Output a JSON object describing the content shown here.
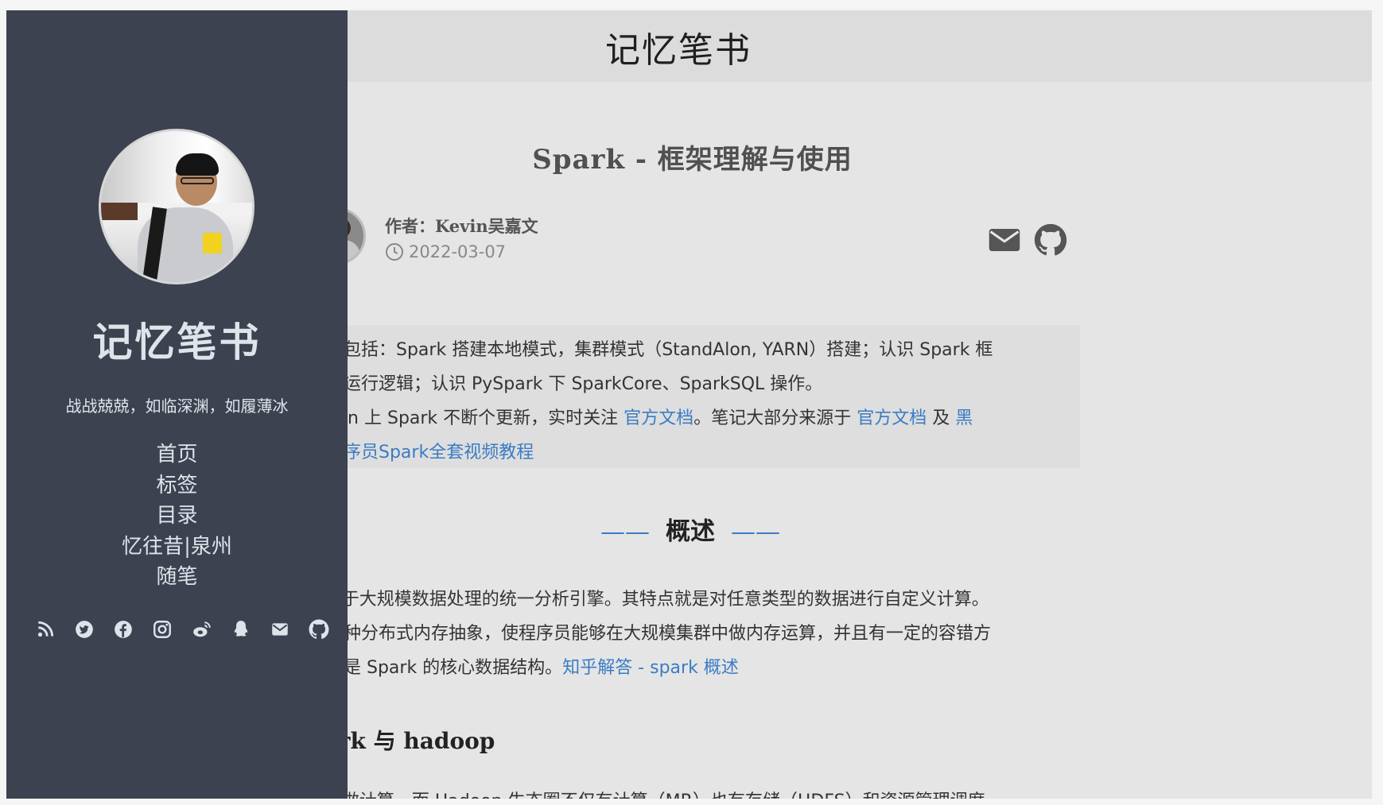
{
  "header": {
    "site_title": "记忆笔书"
  },
  "sidebar": {
    "title": "记忆笔书",
    "motto": "战战兢兢，如临深渊，如履薄冰",
    "nav": [
      "首页",
      "标签",
      "目录",
      "忆往昔|泉州",
      "随笔"
    ],
    "social_icons": [
      "rss-icon",
      "twitter-icon",
      "facebook-icon",
      "instagram-icon",
      "weibo-icon",
      "qq-icon",
      "mail-icon",
      "github-icon"
    ]
  },
  "post": {
    "title": "Spark - 框架理解与使用",
    "author": "作者：Kevin吴嘉文",
    "date": "2022-03-07",
    "meta_icons": [
      "mail-icon",
      "github-icon"
    ]
  },
  "quote": {
    "line1": "内容包括：Spark 搭建本地模式，集群模式（StandAlon, YARN）搭建；认识 Spark 框",
    "line2": "果、运行逻辑；认识 PySpark 下 SparkCore、SparkSQL 操作。",
    "line3_pre": "ython 上 Spark 不断个更新，实时关注 ",
    "link1": "官方文档",
    "line3_mid": "。笔记大部分来源于 ",
    "link2": "官方文档",
    "line3_and": " 及 ",
    "link3a": "黑",
    "link3b": "马程序员Spark全套视频教程"
  },
  "section": {
    "dash_left": "——",
    "heading": "概述",
    "dash_right": "——"
  },
  "overview": {
    "line1": "k 用于大规模数据处理的统一分析引擎。其特点就是对任意类型的数据进行自定义计算。",
    "line2": "是一种分布式内存抽象，使程序员能够在大规模集群中做内存运算，并且有一定的容错方",
    "line3_pre": "这也是 Spark 的核心数据结构。",
    "link": "知乎解答 - spark 概述"
  },
  "subsection": {
    "heading": "park 与 hadoop"
  },
  "cutoff_line": "k 仅做计算，而 Hadoop 生态圈不仅有计算（MR）也有存储（HDFS）和资源管理调度",
  "colors": {
    "sidebar_bg": "#3d4250",
    "link": "#3a7cc4",
    "page_bg": "#e5e5e5"
  }
}
